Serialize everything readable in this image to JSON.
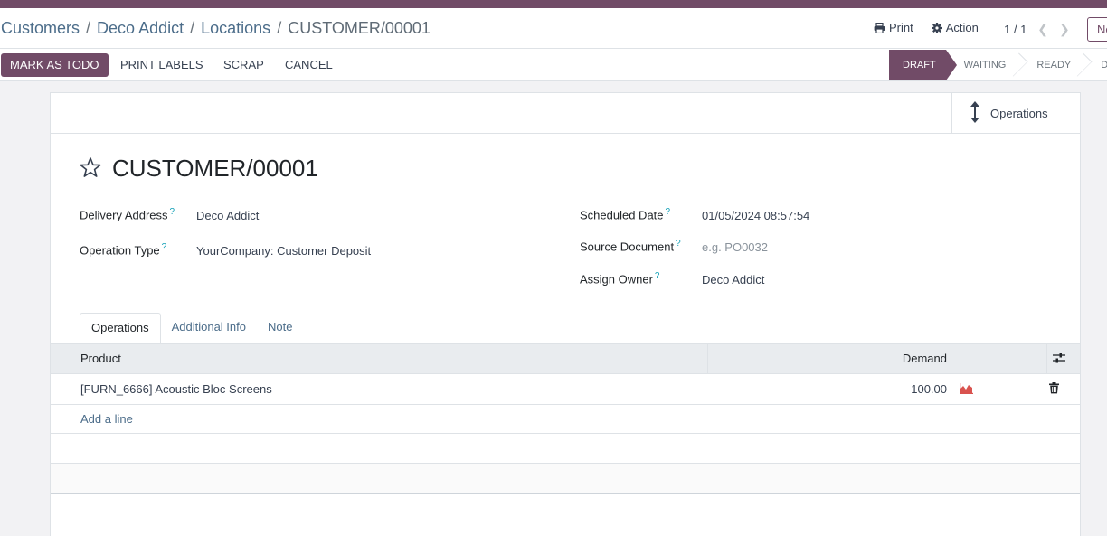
{
  "breadcrumb": {
    "items": [
      "Customers",
      "Deco Addict",
      "Locations"
    ],
    "separator": "/",
    "current": "CUSTOMER/00001"
  },
  "toolbar": {
    "print_label": "Print",
    "action_label": "Action",
    "pager": "1 / 1",
    "new_label": "Ne"
  },
  "actions": {
    "mark_as_todo": "MARK AS TODO",
    "print_labels": "PRINT LABELS",
    "scrap": "SCRAP",
    "cancel": "CANCEL"
  },
  "status": {
    "stages": [
      "DRAFT",
      "WAITING",
      "READY",
      "D"
    ],
    "active": "DRAFT"
  },
  "smart_button": {
    "operations_label": "Operations"
  },
  "record": {
    "title": "CUSTOMER/00001",
    "help_marker": "?",
    "fields_left": [
      {
        "label": "Delivery Address",
        "value": "Deco Addict"
      },
      {
        "label": "Operation Type",
        "value": "YourCompany: Customer Deposit"
      }
    ],
    "fields_right": [
      {
        "label": "Scheduled Date",
        "value": "01/05/2024 08:57:54"
      },
      {
        "label": "Source Document",
        "placeholder": "e.g. PO0032"
      },
      {
        "label": "Assign Owner",
        "value": "Deco Addict"
      }
    ]
  },
  "tabs": [
    {
      "label": "Operations",
      "active": true
    },
    {
      "label": "Additional Info",
      "active": false
    },
    {
      "label": "Note",
      "active": false
    }
  ],
  "table": {
    "columns": [
      "Product",
      "Demand"
    ],
    "rows": [
      {
        "product": "[FURN_6666] Acoustic Bloc Screens",
        "demand": "100.00"
      }
    ],
    "add_line": "Add a line"
  },
  "colors": {
    "brand": "#714b67",
    "link": "#4c6d8a",
    "forecast_icon": "#d9534f"
  }
}
